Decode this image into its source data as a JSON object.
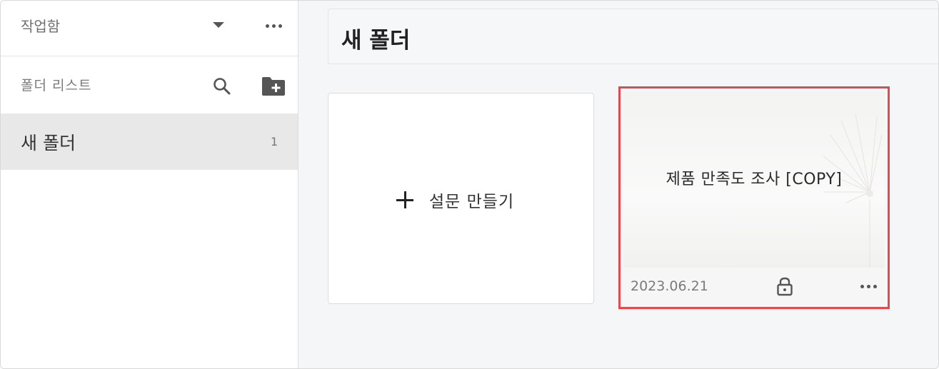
{
  "sidebar": {
    "workspace_label": "작업함",
    "folder_list_label": "폴더 리스트",
    "folders": [
      {
        "name": "새 폴더",
        "count": "1"
      }
    ]
  },
  "main": {
    "title": "새 폴더",
    "create_label": "설문 만들기",
    "surveys": [
      {
        "title": "제품 만족도 조사 [COPY]",
        "date": "2023.06.21"
      }
    ]
  },
  "colors": {
    "selection_border": "#e5484d",
    "active_folder_bg": "#e8e8e8"
  },
  "icons": [
    "caret-down-icon",
    "more-horizontal-icon",
    "search-icon",
    "add-folder-icon",
    "plus-icon",
    "lock-icon"
  ]
}
